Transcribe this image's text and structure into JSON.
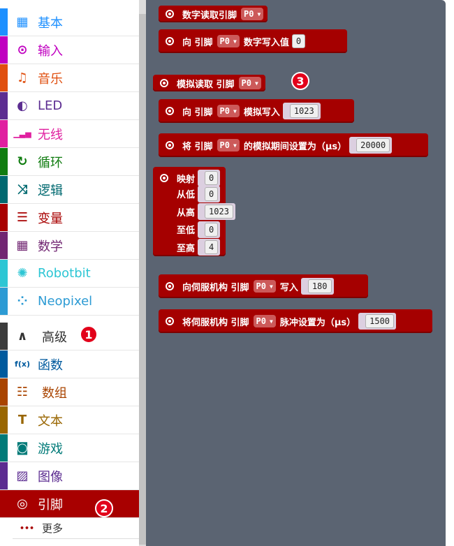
{
  "sidebar": {
    "categories": [
      {
        "label": "基本",
        "color": "#1e90ff",
        "icon": "grid-icon",
        "glyph": "▦"
      },
      {
        "label": "输入",
        "color": "#c000c0",
        "icon": "target-icon",
        "glyph": "⊙"
      },
      {
        "label": "音乐",
        "color": "#e05010",
        "icon": "headphones-icon",
        "glyph": "♫"
      },
      {
        "label": "LED",
        "color": "#5c2d91",
        "icon": "toggle-icon",
        "glyph": "◐"
      },
      {
        "label": "无线",
        "color": "#e020a0",
        "icon": "signal-bars-icon",
        "glyph": "▁▃▅"
      },
      {
        "label": "循环",
        "color": "#107c10",
        "icon": "refresh-icon",
        "glyph": "↻"
      },
      {
        "label": "逻辑",
        "color": "#006970",
        "icon": "shuffle-icon",
        "glyph": "⤨"
      },
      {
        "label": "变量",
        "color": "#a80000",
        "icon": "list-lines-icon",
        "glyph": "☰"
      },
      {
        "label": "数学",
        "color": "#712672",
        "icon": "calculator-icon",
        "glyph": "▦"
      },
      {
        "label": "Robotbit",
        "color": "#2dc6d4",
        "icon": "rebel-icon",
        "glyph": "✺"
      },
      {
        "label": "Neopixel",
        "color": "#2d9bd4",
        "icon": "dots-ring-icon",
        "glyph": "⁘"
      }
    ],
    "advanced": {
      "label": "高级",
      "color": "#3c3c3c",
      "icon": "chevron-up-icon",
      "glyph": "∧",
      "badge": "1"
    },
    "advanced_items": [
      {
        "label": "函数",
        "color": "#005a9e",
        "icon": "function-icon",
        "glyph": "f(x)"
      },
      {
        "label": "数组",
        "color": "#a94400",
        "icon": "list-numbered-icon",
        "glyph": "☷"
      },
      {
        "label": "文本",
        "color": "#996600",
        "icon": "text-icon",
        "glyph": "T"
      },
      {
        "label": "游戏",
        "color": "#007a78",
        "icon": "gamepad-icon",
        "glyph": "◙"
      },
      {
        "label": "图像",
        "color": "#5c2d91",
        "icon": "image-icon",
        "glyph": "▨"
      }
    ],
    "selected": {
      "label": "引脚",
      "color": "#a80000",
      "icon": "pin-icon",
      "glyph": "◎",
      "badge": "2"
    },
    "more": {
      "label": "更多",
      "icon": "more-dots-icon",
      "glyph": "•••"
    }
  },
  "blocks": {
    "digital_read": {
      "text": "数字读取引脚",
      "pin": "P0"
    },
    "digital_write": {
      "pre": "向  引脚",
      "pin": "P0",
      "post": "数字写入值",
      "value": "0"
    },
    "analog_read": {
      "text": "模拟读取  引脚",
      "pin": "P0",
      "badge": "3"
    },
    "analog_write": {
      "pre": "向  引脚",
      "pin": "P0",
      "post": "模拟写入",
      "value": "1023"
    },
    "analog_period": {
      "pre": "将  引脚",
      "pin": "P0",
      "post": "的模拟期间设置为（µs）",
      "value": "20000"
    },
    "map": {
      "title": "映射",
      "value": "0",
      "from_low_label": "从低",
      "from_low": "0",
      "from_high_label": "从高",
      "from_high": "1023",
      "to_low_label": "至低",
      "to_low": "0",
      "to_high_label": "至高",
      "to_high": "4"
    },
    "servo_write": {
      "pre": "向伺服机构  引脚",
      "pin": "P0",
      "post": "写入",
      "value": "180"
    },
    "servo_pulse": {
      "pre": "将伺服机构  引脚",
      "pin": "P0",
      "post": "脉冲设置为（µs）",
      "value": "1500"
    }
  }
}
